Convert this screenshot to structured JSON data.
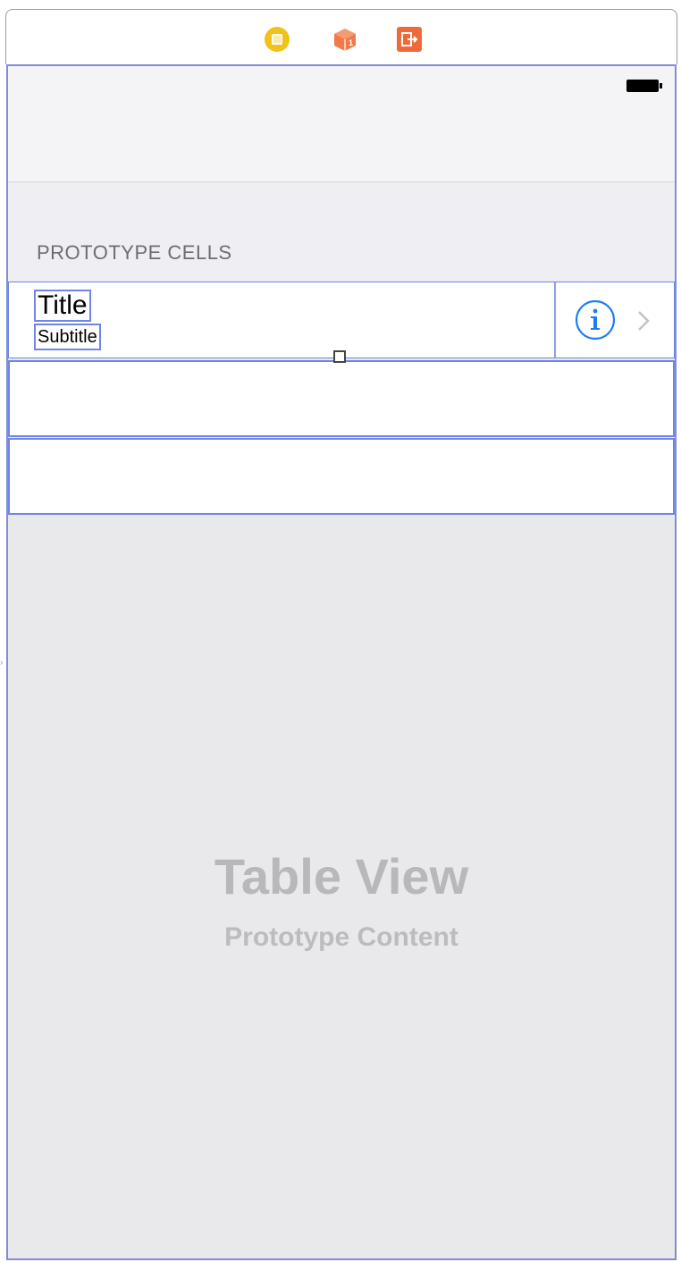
{
  "scene_dock": {
    "icons": [
      "view-controller-icon",
      "first-responder-icon",
      "exit-icon"
    ]
  },
  "table": {
    "section_header": "PROTOTYPE CELLS",
    "cells": [
      {
        "title": "Title",
        "subtitle": "Subtitle",
        "accessory": "detail-disclosure"
      },
      {
        "title": "",
        "subtitle": ""
      },
      {
        "title": "",
        "subtitle": ""
      }
    ],
    "placeholder": {
      "title": "Table View",
      "subtitle": "Prototype Content"
    }
  },
  "colors": {
    "selection_outline": "#6f86e6",
    "info_blue": "#1e7cf2",
    "dock_vc": "#f2c21b",
    "dock_cube": "#f07a4a",
    "dock_exit": "#ef6a3a",
    "placeholder_text": "#b8b8bc"
  }
}
